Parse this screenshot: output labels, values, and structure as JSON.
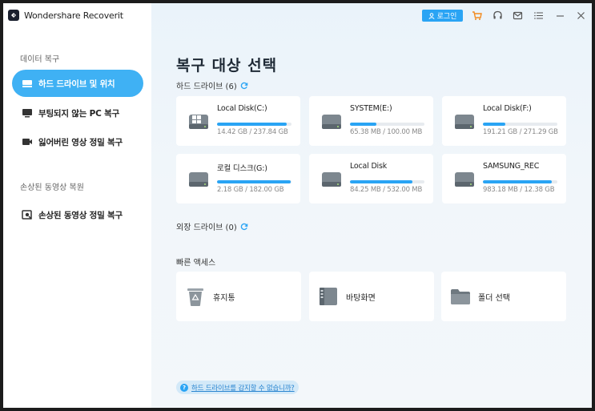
{
  "app": {
    "title": "Wondershare Recoverit"
  },
  "topbar": {
    "login_label": "로그인"
  },
  "sidebar": {
    "section1": "데이터 복구",
    "section2": "손상된 동영상 복원",
    "items": [
      {
        "label": "하드 드라이브 및 위치",
        "icon": "hard-drive-icon",
        "active": true
      },
      {
        "label": "부팅되지 않는 PC 복구",
        "icon": "monitor-icon",
        "active": false
      },
      {
        "label": "잃어버린 영상 정밀 복구",
        "icon": "video-camera-icon",
        "active": false
      },
      {
        "label": "손상된 동영상 정밀 복구",
        "icon": "video-repair-icon",
        "active": false
      }
    ]
  },
  "main": {
    "title": "복구 대상 선택",
    "hard_drives_label": "하드 드라이브 (6)",
    "external_drives_label": "외장 드라이브 (0)",
    "quick_access_label": "빠른 액세스",
    "drives": [
      {
        "name": "Local Disk(C:)",
        "size": "14.42 GB / 237.84 GB",
        "usage": 0.94,
        "system": true
      },
      {
        "name": "SYSTEM(E:)",
        "size": "65.38 MB / 100.00 MB",
        "usage": 0.35,
        "system": false
      },
      {
        "name": "Local Disk(F:)",
        "size": "191.21 GB / 271.29 GB",
        "usage": 0.3,
        "system": false
      },
      {
        "name": "로컬 디스크(G:)",
        "size": "2.18 GB / 182.00 GB",
        "usage": 0.99,
        "system": false
      },
      {
        "name": "Local Disk",
        "size": "84.25 MB / 532.00 MB",
        "usage": 0.84,
        "system": false
      },
      {
        "name": "SAMSUNG_REC",
        "size": "983.18 MB / 12.38 GB",
        "usage": 0.92,
        "system": false
      }
    ],
    "quick": [
      {
        "label": "휴지통",
        "icon": "recycle-bin-icon"
      },
      {
        "label": "바탕화면",
        "icon": "desktop-icon"
      },
      {
        "label": "폴더 선택",
        "icon": "folder-icon"
      }
    ],
    "help_text": "하드 드라이브를 감지할 수 없습니까?"
  },
  "colors": {
    "accent": "#2aa4f4",
    "active_nav": "#3fb1f4"
  }
}
